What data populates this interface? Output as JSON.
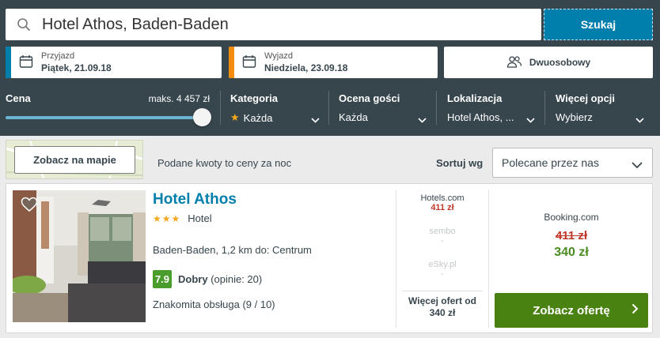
{
  "search": {
    "query": "Hotel Athos, Baden-Baden",
    "button": "Szukaj"
  },
  "dates": {
    "checkin_label": "Przyjazd",
    "checkin_value": "Piątek, 21.09.18",
    "checkout_label": "Wyjazd",
    "checkout_value": "Niedziela, 23.09.18",
    "checkin_color": "#007fad",
    "checkout_color": "#f28c0f"
  },
  "room": {
    "label": "Dwuosobowy",
    "icon": "people-icon"
  },
  "filters": {
    "price_title": "Cena",
    "price_max": "maks. 4 457 zł",
    "price_level_percent": 100,
    "category_title": "Kategoria",
    "category_value": "Każda",
    "rating_title": "Ocena gości",
    "rating_value": "Każda",
    "location_title": "Lokalizacja",
    "location_value": "Hotel Athos, ...",
    "more_title": "Więcej opcji",
    "more_value": "Wybierz"
  },
  "results_bar": {
    "map_button": "Zobacz na mapie",
    "price_note": "Podane kwoty to ceny za noc",
    "sort_label": "Sortuj wg",
    "sort_value": "Polecane przez nas"
  },
  "hotel": {
    "name": "Hotel Athos",
    "stars": "★★★",
    "star_count": 3,
    "type": "Hotel",
    "location": "Baden-Baden, 1,2 km do: Centrum",
    "score": "7.9",
    "rating_label": "Dobry",
    "reviews": "(opinie: 20)",
    "service": "Znakomita obsługa (9 / 10)",
    "offers": [
      {
        "provider": "Hotels.com",
        "price": "411 zł",
        "available": true
      },
      {
        "provider": "sembo",
        "price": "-",
        "available": false
      },
      {
        "provider": "eSky.pl",
        "price": "-",
        "available": false
      }
    ],
    "more_offers": "Więcej ofert od",
    "more_offers_price": "340 zł",
    "best_provider": "Booking.com",
    "old_price": "411 zł",
    "best_price": "340 zł",
    "cta": "Zobacz ofertę"
  }
}
